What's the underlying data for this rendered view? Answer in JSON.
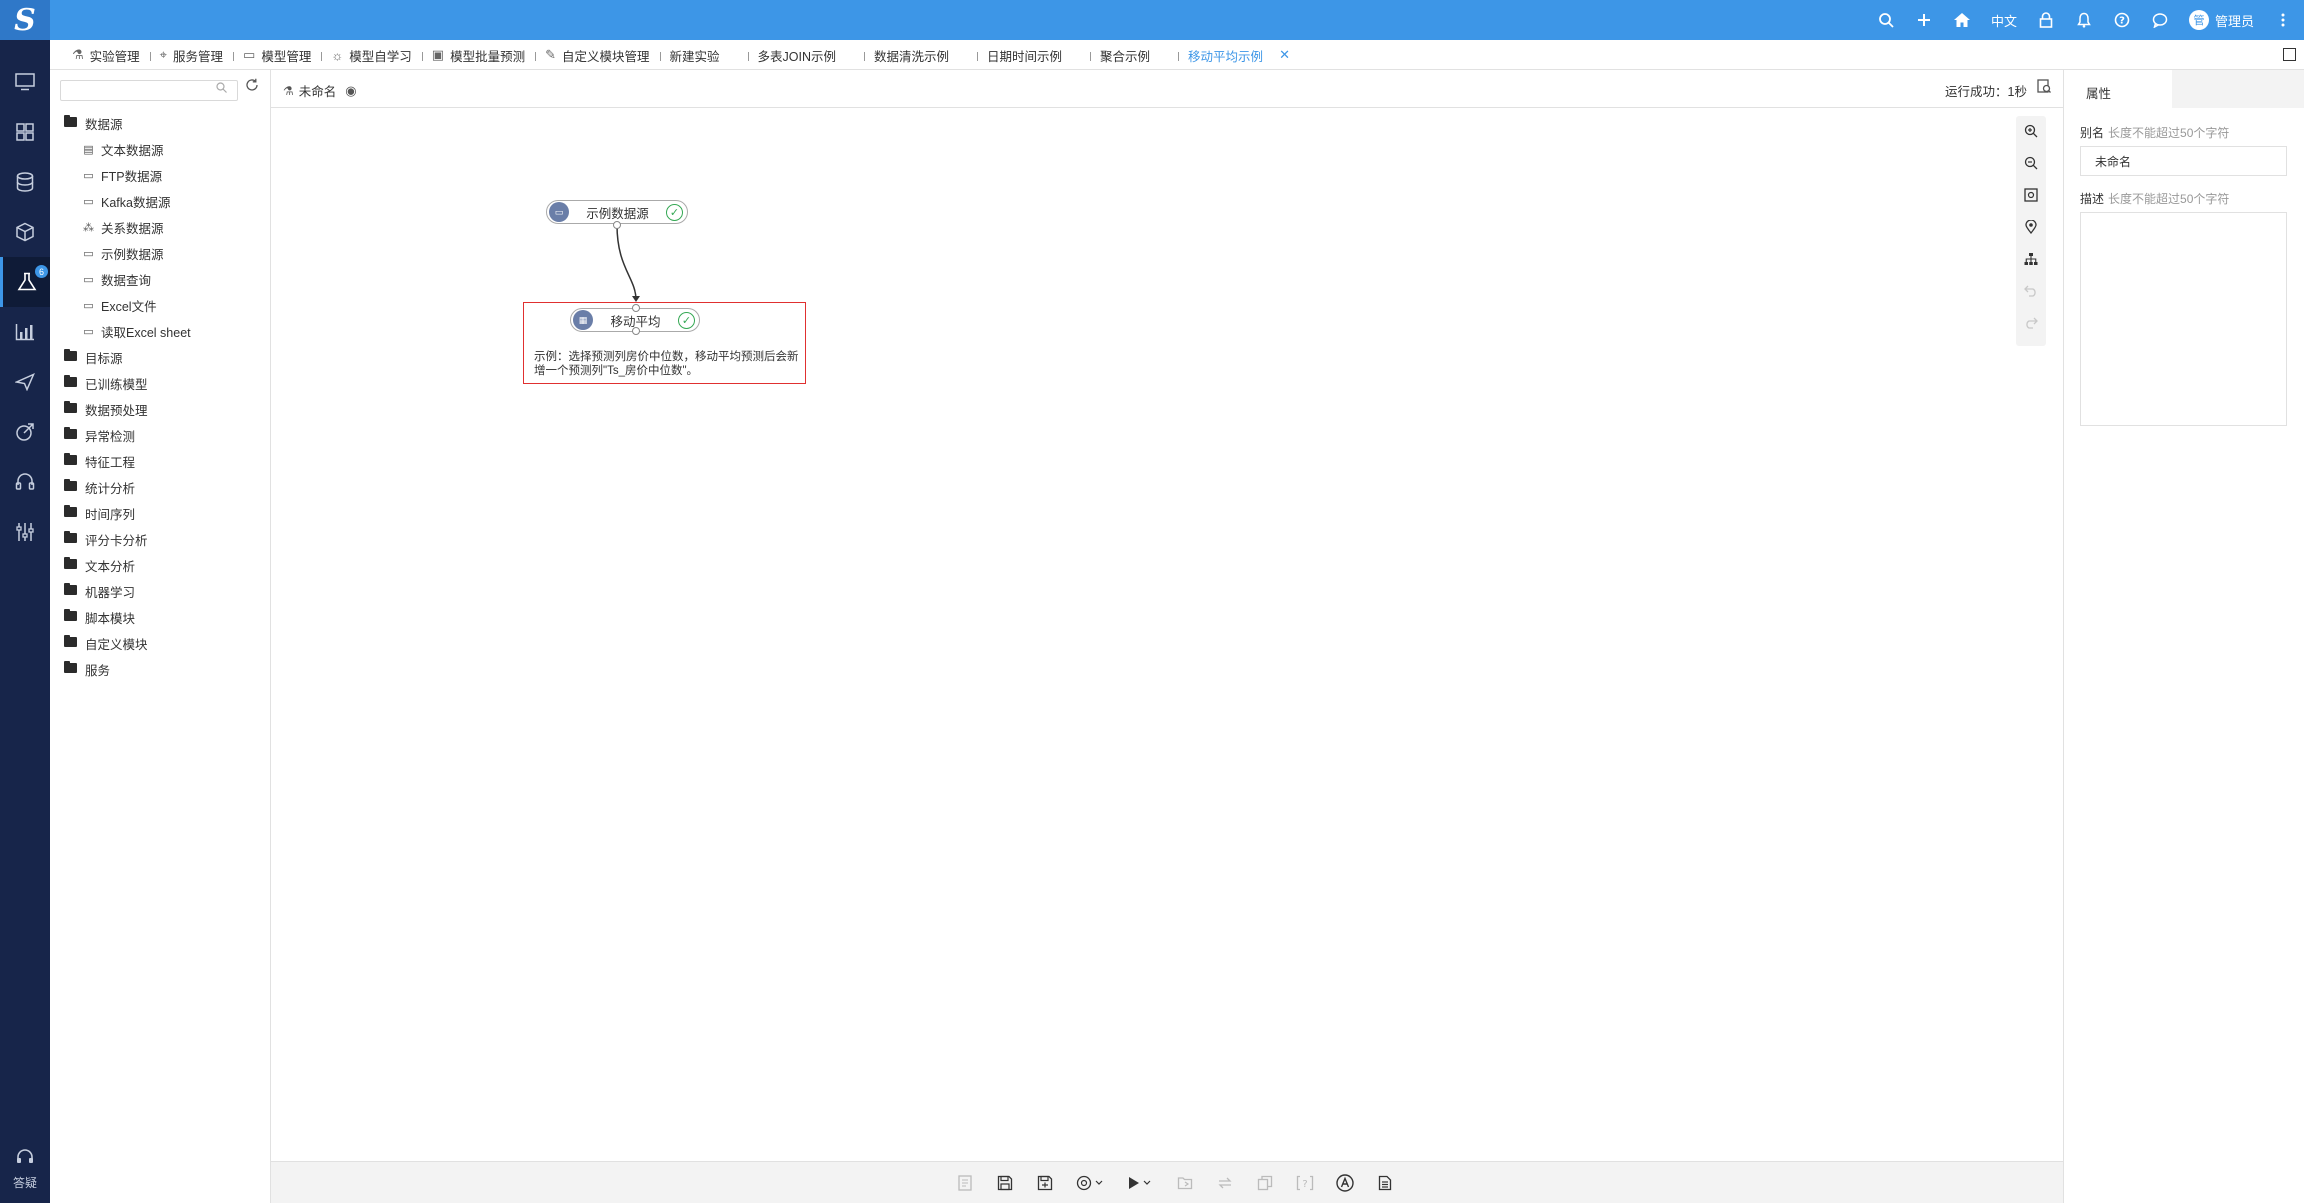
{
  "topbar": {
    "logo": "S",
    "language": "中文",
    "avatar_text": "管",
    "user_name": "管理员",
    "icons": [
      "search-icon",
      "plus-icon",
      "home-icon",
      "lock-icon",
      "bell-icon",
      "help-icon",
      "chat-icon",
      "more-icon"
    ]
  },
  "leftnav": {
    "badge": "6",
    "help_label": "答疑"
  },
  "tabs": [
    {
      "label": "实验管理"
    },
    {
      "label": "服务管理"
    },
    {
      "label": "模型管理"
    },
    {
      "label": "模型自学习"
    },
    {
      "label": "模型批量预测"
    },
    {
      "label": "自定义模块管理"
    },
    {
      "label": "新建实验"
    },
    {
      "label": "多表JOIN示例"
    },
    {
      "label": "数据清洗示例"
    },
    {
      "label": "日期时间示例"
    },
    {
      "label": "聚合示例"
    },
    {
      "label": "移动平均示例",
      "active": true
    }
  ],
  "tree": {
    "search_placeholder": "",
    "root": "数据源",
    "children": [
      "文本数据源",
      "FTP数据源",
      "Kafka数据源",
      "关系数据源",
      "示例数据源",
      "数据查询",
      "Excel文件",
      "读取Excel sheet"
    ],
    "folders": [
      "目标源",
      "已训练模型",
      "数据预处理",
      "异常检测",
      "特征工程",
      "统计分析",
      "时间序列",
      "评分卡分析",
      "文本分析",
      "机器学习",
      "脚本模块",
      "自定义模块",
      "服务"
    ]
  },
  "canvas": {
    "name": "未命名",
    "run_status": "运行成功：1秒",
    "nodes": [
      {
        "label": "示例数据源",
        "status": "success"
      },
      {
        "label": "移动平均",
        "status": "success"
      }
    ],
    "annotation": "示例：选择预测列房价中位数，移动平均预测后会新增一个预测列\"Ts_房价中位数\"。"
  },
  "properties": {
    "tab": "属性",
    "alias_label": "别名",
    "alias_hint": "长度不能超过50个字符",
    "alias_value": "未命名",
    "desc_label": "描述",
    "desc_hint": "长度不能超过50个字符",
    "desc_value": ""
  }
}
